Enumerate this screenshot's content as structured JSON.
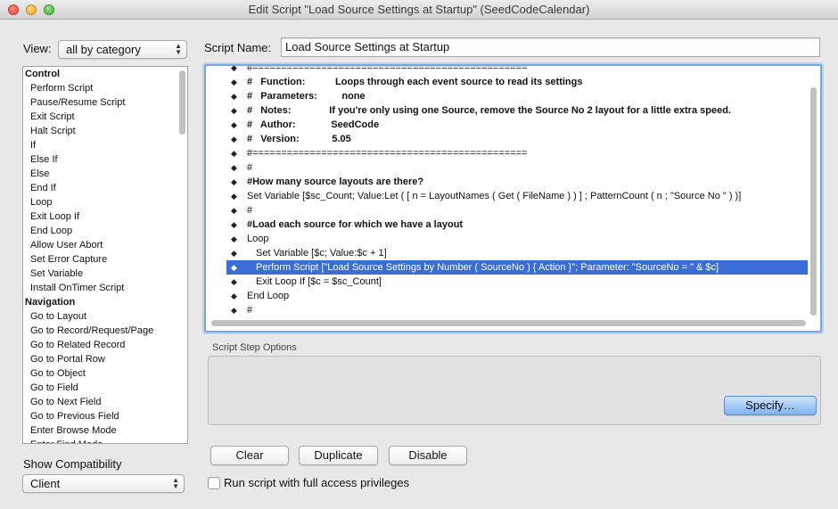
{
  "window": {
    "title": "Edit Script \"Load Source Settings at Startup\" (SeedCodeCalendar)"
  },
  "view": {
    "label": "View:",
    "value": "all by category"
  },
  "script_name": {
    "label": "Script Name:",
    "value": "Load Source Settings at Startup"
  },
  "steps": [
    {
      "label": "Control",
      "category": true
    },
    {
      "label": "Perform Script"
    },
    {
      "label": "Pause/Resume Script"
    },
    {
      "label": "Exit Script"
    },
    {
      "label": "Halt Script"
    },
    {
      "label": "If"
    },
    {
      "label": "Else If"
    },
    {
      "label": "Else"
    },
    {
      "label": "End If"
    },
    {
      "label": "Loop"
    },
    {
      "label": "Exit Loop If"
    },
    {
      "label": "End Loop"
    },
    {
      "label": "Allow User Abort"
    },
    {
      "label": "Set Error Capture"
    },
    {
      "label": "Set Variable"
    },
    {
      "label": "Install OnTimer Script"
    },
    {
      "label": "Navigation",
      "category": true
    },
    {
      "label": "Go to Layout"
    },
    {
      "label": "Go to Record/Request/Page"
    },
    {
      "label": "Go to Related Record"
    },
    {
      "label": "Go to Portal Row"
    },
    {
      "label": "Go to Object"
    },
    {
      "label": "Go to Field"
    },
    {
      "label": "Go to Next Field"
    },
    {
      "label": "Go to Previous Field"
    },
    {
      "label": "Enter Browse Mode"
    },
    {
      "label": "Enter Find Mode"
    }
  ],
  "script_lines": [
    {
      "indent": 0,
      "bold": false,
      "selected": false,
      "text": "#================================================"
    },
    {
      "indent": 0,
      "bold": true,
      "selected": false,
      "text": "#   Function:           Loops through each event source to read its settings"
    },
    {
      "indent": 0,
      "bold": true,
      "selected": false,
      "text": "#   Parameters:         none"
    },
    {
      "indent": 0,
      "bold": true,
      "selected": false,
      "text": "#   Notes:              If you're only using one Source, remove the Source No 2 layout for a little extra speed."
    },
    {
      "indent": 0,
      "bold": true,
      "selected": false,
      "text": "#   Author:             SeedCode"
    },
    {
      "indent": 0,
      "bold": true,
      "selected": false,
      "text": "#   Version:            5.05"
    },
    {
      "indent": 0,
      "bold": false,
      "selected": false,
      "text": "#================================================"
    },
    {
      "indent": 0,
      "bold": false,
      "selected": false,
      "text": "#"
    },
    {
      "indent": 0,
      "bold": true,
      "selected": false,
      "text": "#How many source layouts are there?"
    },
    {
      "indent": 0,
      "bold": false,
      "selected": false,
      "text": "Set Variable [$sc_Count; Value:Let ( [ n = LayoutNames ( Get ( FileName ) ) ] ; PatternCount ( n ; \"Source No \" ) )]"
    },
    {
      "indent": 0,
      "bold": false,
      "selected": false,
      "text": "#"
    },
    {
      "indent": 0,
      "bold": true,
      "selected": false,
      "text": "#Load each source for which we have a layout"
    },
    {
      "indent": 0,
      "bold": false,
      "selected": false,
      "text": "Loop"
    },
    {
      "indent": 1,
      "bold": false,
      "selected": false,
      "text": "Set Variable [$c; Value:$c + 1]"
    },
    {
      "indent": 1,
      "bold": false,
      "selected": true,
      "text": "Perform Script [\"Load Source Settings by Number ( SourceNo ) { Action }\"; Parameter: \"SourceNo = \" & $c]"
    },
    {
      "indent": 1,
      "bold": false,
      "selected": false,
      "text": "Exit Loop If [$c = $sc_Count]"
    },
    {
      "indent": 0,
      "bold": false,
      "selected": false,
      "text": "End Loop"
    },
    {
      "indent": 0,
      "bold": false,
      "selected": false,
      "text": "#"
    }
  ],
  "options": {
    "label": "Script Step Options",
    "specify_label": "Specify…"
  },
  "buttons": {
    "clear": "Clear",
    "duplicate": "Duplicate",
    "disable": "Disable"
  },
  "compatibility": {
    "label": "Show Compatibility",
    "value": "Client"
  },
  "full_access": {
    "label": "Run script with full access privileges",
    "checked": false
  },
  "colors": {
    "selection": "#3a6ed6",
    "focus_ring": "#7aa6e0",
    "default_button": "#7eb3ee"
  }
}
